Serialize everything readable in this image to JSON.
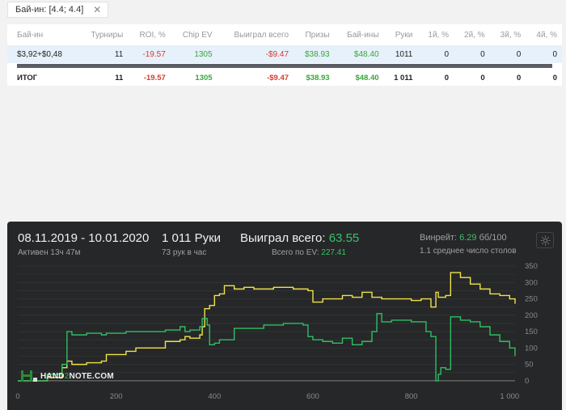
{
  "filter": {
    "label": "Бай-ин: [4.4; 4.4]",
    "close_glyph": "✕"
  },
  "table": {
    "headers": [
      "Бай-ин",
      "Турниры",
      "ROI, %",
      "Chip EV",
      "Выиграл всего",
      "Призы",
      "Бай-ины",
      "Руки",
      "1й, %",
      "2й, %",
      "3й, %",
      "4й, %"
    ],
    "row": [
      "$3,92+$0,48",
      "11",
      "-19.57",
      "1305",
      "-$9.47",
      "$38.93",
      "$48.40",
      "1011",
      "0",
      "0",
      "0",
      "0"
    ],
    "total": [
      "ИТОГ",
      "11",
      "-19.57",
      "1305",
      "-$9.47",
      "$38.93",
      "$48.40",
      "1 011",
      "0",
      "0",
      "0",
      "0"
    ]
  },
  "summary": {
    "date_range": "08.11.2019 - 10.01.2020",
    "active": "Активен 13ч 47м",
    "hands": "1 011 Руки",
    "hands_per_hour": "73 рук в час",
    "won_label": "Выиграл всего:",
    "won_value": "63.55",
    "ev_label": "Всего по EV:",
    "ev_value": "227.41",
    "winrate_label": "Винрейт:",
    "winrate_value": "6.29",
    "winrate_unit": "бб/100",
    "avg_tables": "1.1 среднее число столов"
  },
  "logo": {
    "text_a": "HAND",
    "text_b": "2",
    "text_c": "NOTE.COM"
  },
  "colors": {
    "ev_line": "#f0e34a",
    "won_line": "#2fbf64",
    "grid": "#3a3b3d",
    "axis_text": "#8a8a8a"
  },
  "chart_data": {
    "type": "line",
    "x_ticks": [
      "0",
      "200",
      "400",
      "600",
      "800",
      "1 000"
    ],
    "y_ticks": [
      "0",
      "50",
      "100",
      "150",
      "200",
      "250",
      "300",
      "350"
    ],
    "xlim": [
      0,
      1011
    ],
    "ylim": [
      -20,
      350
    ],
    "series": [
      {
        "key": "ev",
        "x": [
          0,
          60,
          90,
          100,
          110,
          140,
          170,
          180,
          220,
          240,
          260,
          300,
          330,
          340,
          350,
          370,
          375,
          380,
          390,
          400,
          410,
          420,
          440,
          460,
          480,
          520,
          560,
          590,
          600,
          610,
          620,
          640,
          660,
          680,
          700,
          720,
          740,
          760,
          800,
          820,
          840,
          850,
          855,
          870,
          880,
          900,
          920,
          940,
          960,
          980,
          1000,
          1011
        ],
        "y": [
          0,
          10,
          40,
          60,
          50,
          55,
          60,
          80,
          90,
          100,
          100,
          120,
          125,
          135,
          130,
          140,
          165,
          220,
          230,
          260,
          265,
          290,
          280,
          285,
          280,
          285,
          280,
          275,
          240,
          240,
          250,
          250,
          260,
          255,
          270,
          255,
          250,
          250,
          245,
          250,
          225,
          270,
          255,
          260,
          330,
          315,
          295,
          280,
          265,
          260,
          250,
          235
        ]
      },
      {
        "key": "won",
        "x": [
          0,
          60,
          90,
          100,
          110,
          140,
          170,
          180,
          220,
          240,
          260,
          300,
          330,
          340,
          350,
          370,
          375,
          385,
          390,
          400,
          410,
          440,
          470,
          500,
          540,
          560,
          580,
          590,
          600,
          620,
          640,
          660,
          680,
          700,
          720,
          730,
          740,
          760,
          800,
          830,
          840,
          850,
          855,
          860,
          870,
          880,
          900,
          920,
          940,
          960,
          980,
          1000,
          1011
        ],
        "y": [
          0,
          20,
          50,
          150,
          140,
          145,
          140,
          145,
          150,
          150,
          150,
          155,
          165,
          150,
          155,
          165,
          190,
          170,
          110,
          115,
          125,
          160,
          160,
          170,
          175,
          175,
          170,
          135,
          125,
          120,
          115,
          130,
          110,
          120,
          150,
          205,
          180,
          185,
          180,
          150,
          135,
          0,
          20,
          40,
          35,
          195,
          185,
          180,
          165,
          140,
          120,
          100,
          75
        ]
      }
    ]
  }
}
